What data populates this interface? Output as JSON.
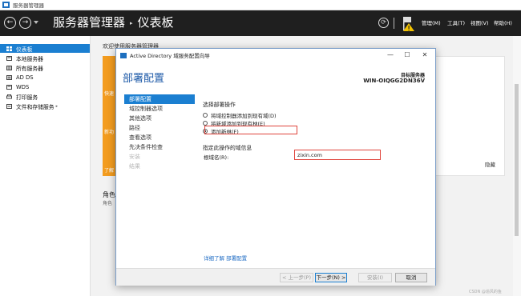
{
  "window": {
    "title": "服务器管理器"
  },
  "header": {
    "breadcrumb_root": "服务器管理器",
    "breadcrumb_sep": "▸",
    "breadcrumb_page": "仪表板",
    "menus": [
      "管理(M)",
      "工具(T)",
      "视图(V)",
      "帮助(H)"
    ]
  },
  "sidebar": {
    "items": [
      {
        "label": "仪表板",
        "active": true
      },
      {
        "label": "本地服务器"
      },
      {
        "label": "所有服务器"
      },
      {
        "label": "AD DS"
      },
      {
        "label": "WDS"
      },
      {
        "label": "打印服务",
        "arrow": ""
      },
      {
        "label": "文件和存储服务",
        "arrow": "▸"
      }
    ]
  },
  "main": {
    "welcome": "欢迎使用服务器管理器",
    "tile_texts": [
      "快速",
      "新功",
      "了解"
    ],
    "hide": "隐藏",
    "roles_title": "角色",
    "roles_sub": "角色"
  },
  "wizard": {
    "title": "Active Directory 域服务配置向导",
    "heading": "部署配置",
    "target_label": "目标服务器",
    "target_name": "WIN-OIQGG2DN36V",
    "steps": [
      {
        "label": "部署配置",
        "state": "active"
      },
      {
        "label": "域控制器选项",
        "state": "normal"
      },
      {
        "label": "其他选项",
        "state": "normal"
      },
      {
        "label": "路径",
        "state": "normal"
      },
      {
        "label": "查看选项",
        "state": "normal"
      },
      {
        "label": "先决条件检查",
        "state": "normal"
      },
      {
        "label": "安装",
        "state": "disabled"
      },
      {
        "label": "结果",
        "state": "disabled"
      }
    ],
    "operation_label": "选择部署操作",
    "options": [
      {
        "label": "将域控制器添加到现有域(D)",
        "selected": false
      },
      {
        "label": "将新域添加到现有林(E)",
        "selected": false
      },
      {
        "label": "添加新林(F)",
        "selected": true
      }
    ],
    "domain_section": "指定此操作的域信息",
    "root_domain_label": "根域名(R):",
    "root_domain_value": "zixin.com",
    "more_link": "详细了解 部署配置",
    "buttons": {
      "prev": "< 上一步(P)",
      "next": "下一步(N) >",
      "install": "安装(I)",
      "cancel": "取消"
    }
  },
  "watermark": "CSDN @追风的鱼"
}
